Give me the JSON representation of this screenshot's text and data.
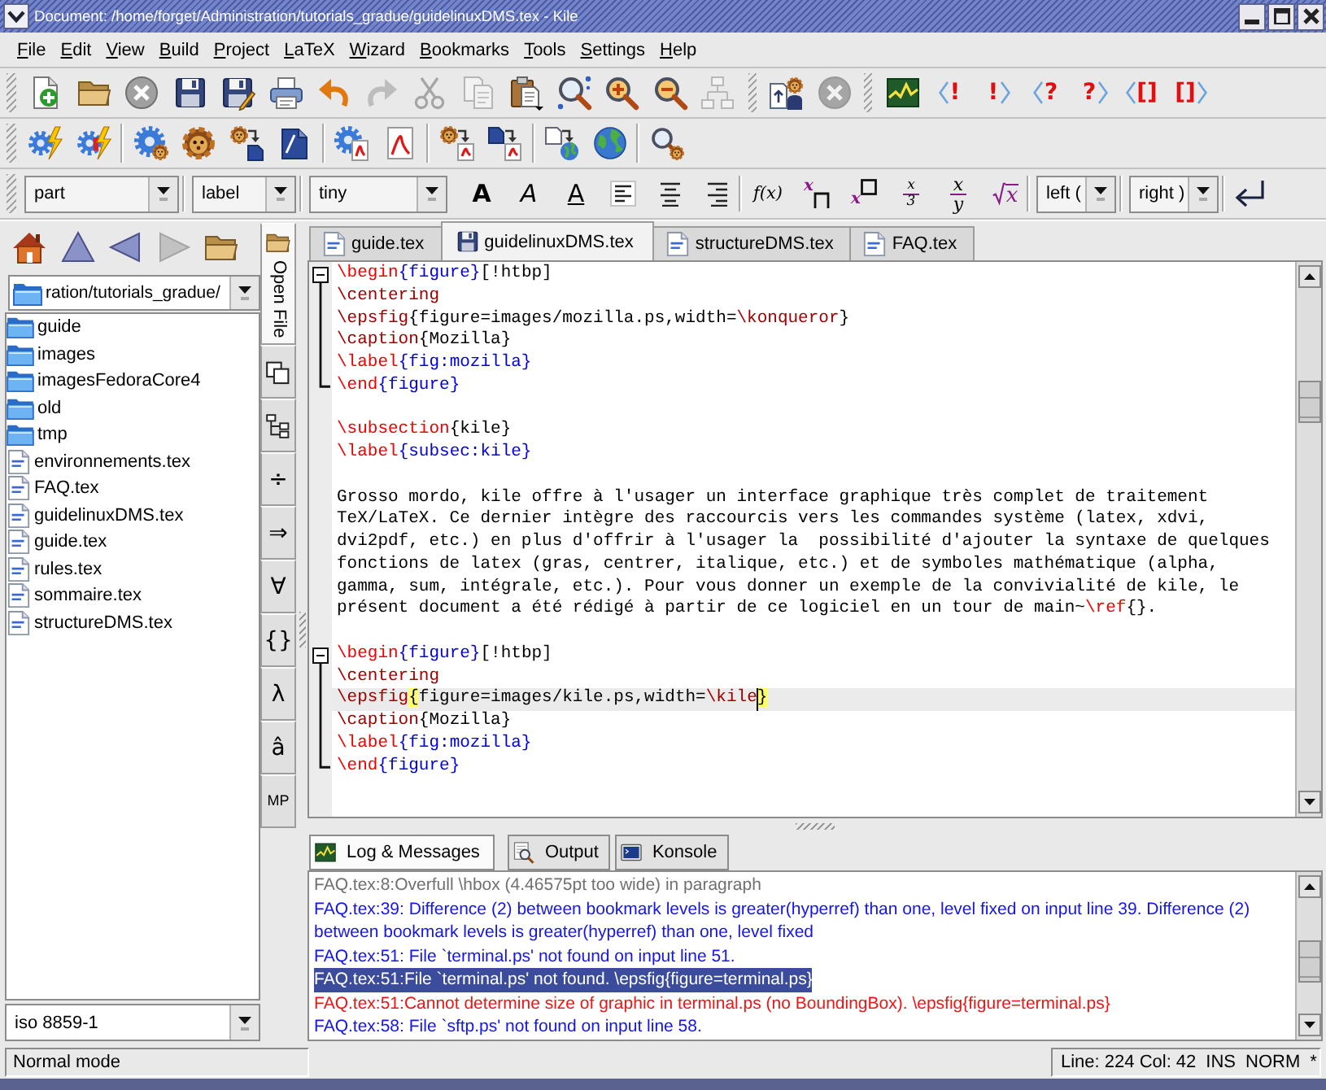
{
  "window": {
    "title": "Document: /home/forget/Administration/tutorials_gradue/guidelinuxDMS.tex - Kile"
  },
  "menu": [
    {
      "label": "File"
    },
    {
      "label": "Edit"
    },
    {
      "label": "View"
    },
    {
      "label": "Build"
    },
    {
      "label": "Project"
    },
    {
      "label": "LaTeX"
    },
    {
      "label": "Wizard"
    },
    {
      "label": "Bookmarks"
    },
    {
      "label": "Tools"
    },
    {
      "label": "Settings"
    },
    {
      "label": "Help"
    }
  ],
  "main_toolbar": {
    "groups": [
      [
        {
          "kind": "new",
          "disabled": false
        },
        {
          "kind": "open",
          "disabled": false
        },
        {
          "kind": "close",
          "disabled": false
        },
        {
          "kind": "save",
          "disabled": false
        },
        {
          "kind": "save-as",
          "disabled": false
        },
        {
          "kind": "print",
          "disabled": false
        },
        {
          "kind": "undo",
          "disabled": false
        },
        {
          "kind": "redo",
          "disabled": true
        },
        {
          "kind": "cut",
          "disabled": true
        },
        {
          "kind": "copy",
          "disabled": true
        },
        {
          "kind": "paste",
          "disabled": false
        },
        {
          "kind": "find",
          "disabled": false
        },
        {
          "kind": "zoom-in",
          "disabled": false
        },
        {
          "kind": "zoom-out",
          "disabled": false
        },
        {
          "kind": "structure",
          "disabled": true
        }
      ],
      [
        {
          "kind": "page-lion",
          "disabled": false
        },
        {
          "kind": "stop",
          "disabled": true
        }
      ],
      [
        {
          "kind": "log",
          "disabled": false
        },
        {
          "kind": "prev",
          "symbol": "!",
          "disabled": false
        },
        {
          "kind": "next",
          "symbol": "!",
          "disabled": false
        },
        {
          "kind": "prev",
          "symbol": "?",
          "disabled": false
        },
        {
          "kind": "next",
          "symbol": "?",
          "disabled": false
        },
        {
          "kind": "prev",
          "symbol": "[]",
          "disabled": false
        },
        {
          "kind": "next",
          "symbol": "[]",
          "disabled": false
        }
      ]
    ]
  },
  "build_toolbar": {
    "groups": [
      [
        {
          "kind": "gear-bolt"
        },
        {
          "kind": "gear-bolt-stop"
        }
      ],
      [
        {
          "kind": "gear-lion"
        },
        {
          "kind": "lion"
        },
        {
          "kind": "lion-to-doc"
        },
        {
          "kind": "doc"
        }
      ],
      [
        {
          "kind": "gear-pdf"
        },
        {
          "kind": "pdf"
        }
      ],
      [
        {
          "kind": "lion-to-pdf"
        },
        {
          "kind": "doc-to-pdf"
        }
      ],
      [
        {
          "kind": "page-to-globe"
        },
        {
          "kind": "globe"
        }
      ],
      [
        {
          "kind": "magnifier-lion"
        }
      ]
    ]
  },
  "format_toolbar": {
    "groups": [
      [
        {
          "kind": "combo",
          "value": "part"
        }
      ],
      [
        {
          "kind": "combo",
          "value": "label"
        }
      ],
      [
        {
          "kind": "combo",
          "value": "tiny"
        },
        {
          "kind": "bold",
          "text": "A"
        },
        {
          "kind": "italic",
          "text": "A"
        },
        {
          "kind": "underline",
          "text": "A"
        },
        {
          "kind": "align-left"
        },
        {
          "kind": "align-center"
        },
        {
          "kind": "align-right"
        }
      ],
      [
        {
          "kind": "function",
          "text": "f(x)"
        },
        {
          "kind": "subscript",
          "text": "x"
        },
        {
          "kind": "superscript",
          "text": "x"
        },
        {
          "kind": "small-fraction",
          "numerator": "x",
          "denominator": "3"
        },
        {
          "kind": "fraction",
          "numerator": "x",
          "denominator": "y"
        },
        {
          "kind": "root",
          "text": "x"
        }
      ],
      [
        {
          "kind": "combo",
          "value": "left ("
        }
      ],
      [
        {
          "kind": "combo",
          "value": "right )"
        }
      ],
      [
        {
          "kind": "newline"
        }
      ]
    ]
  },
  "file_browser": {
    "nav": [
      {
        "kind": "home",
        "disabled": false
      },
      {
        "kind": "up",
        "disabled": false
      },
      {
        "kind": "back",
        "disabled": false
      },
      {
        "kind": "forward",
        "disabled": true
      },
      {
        "kind": "folder",
        "disabled": false
      }
    ],
    "path": "ration/tutorials_gradue/",
    "files": [
      {
        "name": "guide",
        "kind": "folder"
      },
      {
        "name": "images",
        "kind": "folder"
      },
      {
        "name": "imagesFedoraCore4",
        "kind": "folder"
      },
      {
        "name": "old",
        "kind": "folder"
      },
      {
        "name": "tmp",
        "kind": "folder"
      },
      {
        "name": "environnements.tex",
        "kind": "tex"
      },
      {
        "name": "FAQ.tex",
        "kind": "tex"
      },
      {
        "name": "guidelinuxDMS.tex",
        "kind": "tex"
      },
      {
        "name": "guide.tex",
        "kind": "tex"
      },
      {
        "name": "rules.tex",
        "kind": "tex"
      },
      {
        "name": "sommaire.tex",
        "kind": "tex"
      },
      {
        "name": "structureDMS.tex",
        "kind": "tex"
      }
    ],
    "encoding": "iso 8859-1"
  },
  "side_tabs": [
    {
      "kind": "folder",
      "label": "Open File",
      "selected": true
    },
    {
      "kind": "pages",
      "selected": false
    },
    {
      "kind": "tree",
      "selected": false
    },
    {
      "kind": "symbol",
      "text": "÷",
      "selected": false
    },
    {
      "kind": "symbol",
      "text": "⇒",
      "selected": false
    },
    {
      "kind": "symbol",
      "text": "∀",
      "selected": false
    },
    {
      "kind": "symbol",
      "text": "{}",
      "selected": false
    },
    {
      "kind": "symbol",
      "text": "λ",
      "selected": false
    },
    {
      "kind": "symbol",
      "text": "â",
      "selected": false
    },
    {
      "kind": "abbreviation",
      "text": "MP",
      "selected": false
    }
  ],
  "editor": {
    "tabs": [
      {
        "label": "guide.tex",
        "selected": false,
        "modified": false
      },
      {
        "label": "guidelinuxDMS.tex",
        "selected": true,
        "modified": true
      },
      {
        "label": "structureDMS.tex",
        "selected": false,
        "modified": false
      },
      {
        "label": "FAQ.tex",
        "selected": false,
        "modified": false
      }
    ],
    "lines": [
      {
        "kind": "fold",
        "expanded": true,
        "children": [
          {
            "kind": "line",
            "segments": [
              {
                "kind": "keyword",
                "text": "\\begin"
              },
              {
                "kind": "argument",
                "text": "{figure}"
              },
              {
                "kind": "text",
                "text": "[!htbp]"
              }
            ],
            "current": false
          },
          {
            "kind": "line",
            "segments": [
              {
                "kind": "command",
                "text": "\\centering"
              }
            ],
            "current": false
          },
          {
            "kind": "line",
            "segments": [
              {
                "kind": "command",
                "text": "\\epsfig"
              },
              {
                "kind": "text",
                "text": "{figure=images/mozilla.ps,width="
              },
              {
                "kind": "command",
                "text": "\\konqueror"
              },
              {
                "kind": "text",
                "text": "}"
              }
            ],
            "current": false
          },
          {
            "kind": "line",
            "segments": [
              {
                "kind": "command",
                "text": "\\caption"
              },
              {
                "kind": "text",
                "text": "{Mozilla}"
              }
            ],
            "current": false
          },
          {
            "kind": "line",
            "segments": [
              {
                "kind": "keyword",
                "text": "\\label"
              },
              {
                "kind": "argument",
                "text": "{fig:mozilla}"
              }
            ],
            "current": false
          },
          {
            "kind": "line",
            "segments": [
              {
                "kind": "keyword",
                "text": "\\end"
              },
              {
                "kind": "argument",
                "text": "{figure}"
              }
            ],
            "current": false
          }
        ]
      },
      {
        "kind": "line",
        "current": false
      },
      {
        "kind": "line",
        "segments": [
          {
            "kind": "keyword",
            "text": "\\subsection"
          },
          {
            "kind": "text",
            "text": "{kile}"
          }
        ],
        "current": false
      },
      {
        "kind": "line",
        "segments": [
          {
            "kind": "keyword",
            "text": "\\label"
          },
          {
            "kind": "argument",
            "text": "{subsec:kile}"
          }
        ],
        "current": false
      },
      {
        "kind": "line",
        "current": false
      },
      {
        "kind": "line",
        "segments": [
          {
            "kind": "text",
            "text": "Grosso mordo, kile offre à l'usager un interface graphique très complet de traitement"
          }
        ],
        "current": false
      },
      {
        "kind": "line",
        "segments": [
          {
            "kind": "text",
            "text": "TeX/LaTeX. Ce dernier intègre des raccourcis vers les commandes système (latex, xdvi,"
          }
        ],
        "current": false
      },
      {
        "kind": "line",
        "segments": [
          {
            "kind": "text",
            "text": "dvi2pdf, etc.) en plus d'offrir à l'usager la  possibilité d'ajouter la syntaxe de quelques"
          }
        ],
        "current": false
      },
      {
        "kind": "line",
        "segments": [
          {
            "kind": "text",
            "text": "fonctions de latex (gras, centrer, italique, etc.) et de symboles mathématique (alpha,"
          }
        ],
        "current": false
      },
      {
        "kind": "line",
        "segments": [
          {
            "kind": "text",
            "text": "gamma, sum, intégrale, etc.). Pour vous donner un exemple de la convivialité de kile, le"
          }
        ],
        "current": false
      },
      {
        "kind": "line",
        "segments": [
          {
            "kind": "text",
            "text": "présent document a été rédigé à partir de ce logiciel en un tour de main~"
          },
          {
            "kind": "keyword",
            "text": "\\ref"
          },
          {
            "kind": "text",
            "text": "{}."
          }
        ],
        "current": false
      },
      {
        "kind": "line",
        "current": false
      },
      {
        "kind": "fold",
        "expanded": true,
        "children": [
          {
            "kind": "line",
            "segments": [
              {
                "kind": "keyword",
                "text": "\\begin"
              },
              {
                "kind": "argument",
                "text": "{figure}"
              },
              {
                "kind": "text",
                "text": "[!htbp]"
              }
            ],
            "current": false
          },
          {
            "kind": "line",
            "segments": [
              {
                "kind": "command",
                "text": "\\centering"
              }
            ],
            "current": false
          },
          {
            "kind": "line",
            "segments": [
              {
                "kind": "command",
                "text": "\\epsfig"
              },
              {
                "kind": "brace",
                "text": "{"
              },
              {
                "kind": "text",
                "text": "figure=images/kile.ps,width="
              },
              {
                "kind": "command",
                "text": "\\kile"
              },
              {
                "kind": "caret"
              },
              {
                "kind": "brace",
                "text": "}"
              }
            ],
            "current": true
          },
          {
            "kind": "line",
            "segments": [
              {
                "kind": "command",
                "text": "\\caption"
              },
              {
                "kind": "text",
                "text": "{Mozilla}"
              }
            ],
            "current": false
          },
          {
            "kind": "line",
            "segments": [
              {
                "kind": "keyword",
                "text": "\\label"
              },
              {
                "kind": "argument",
                "text": "{fig:mozilla}"
              }
            ],
            "current": false
          },
          {
            "kind": "line",
            "segments": [
              {
                "kind": "keyword",
                "text": "\\end"
              },
              {
                "kind": "argument",
                "text": "{figure}"
              }
            ],
            "current": false
          }
        ]
      }
    ]
  },
  "log": {
    "tabs": [
      {
        "kind": "log",
        "label": "Log & Messages",
        "selected": true
      },
      {
        "kind": "output",
        "label": "Output",
        "selected": false
      },
      {
        "kind": "terminal",
        "label": "Konsole",
        "selected": false
      }
    ],
    "messages": [
      {
        "kind": "badbox",
        "text": "FAQ.tex:8:Overfull \\hbox (4.46575pt too wide) in paragraph",
        "selected": false
      },
      {
        "kind": "warning",
        "text": "FAQ.tex:39: Difference (2) between bookmark levels is greater(hyperref) than one, level fixed on input line 39. Difference (2) between bookmark levels is greater(hyperref) than one, level fixed",
        "selected": false
      },
      {
        "kind": "warning",
        "text": "FAQ.tex:51: File `terminal.ps' not found on input line 51.",
        "selected": false
      },
      {
        "kind": "warning",
        "text": "FAQ.tex:51:File `terminal.ps' not found. \\epsfig{figure=terminal.ps}",
        "selected": true
      },
      {
        "kind": "error",
        "text": "FAQ.tex:51:Cannot determine size of graphic in terminal.ps (no BoundingBox). \\epsfig{figure=terminal.ps}",
        "selected": false
      },
      {
        "kind": "warning",
        "text": "FAQ.tex:58: File `sftp.ps' not found on input line 58.",
        "selected": false
      }
    ]
  },
  "status_bar": {
    "mode": "Normal mode",
    "position": "Line: 224 Col: 42",
    "insert_mode": "INS",
    "selection_mode": "NORM",
    "modified": "*"
  }
}
